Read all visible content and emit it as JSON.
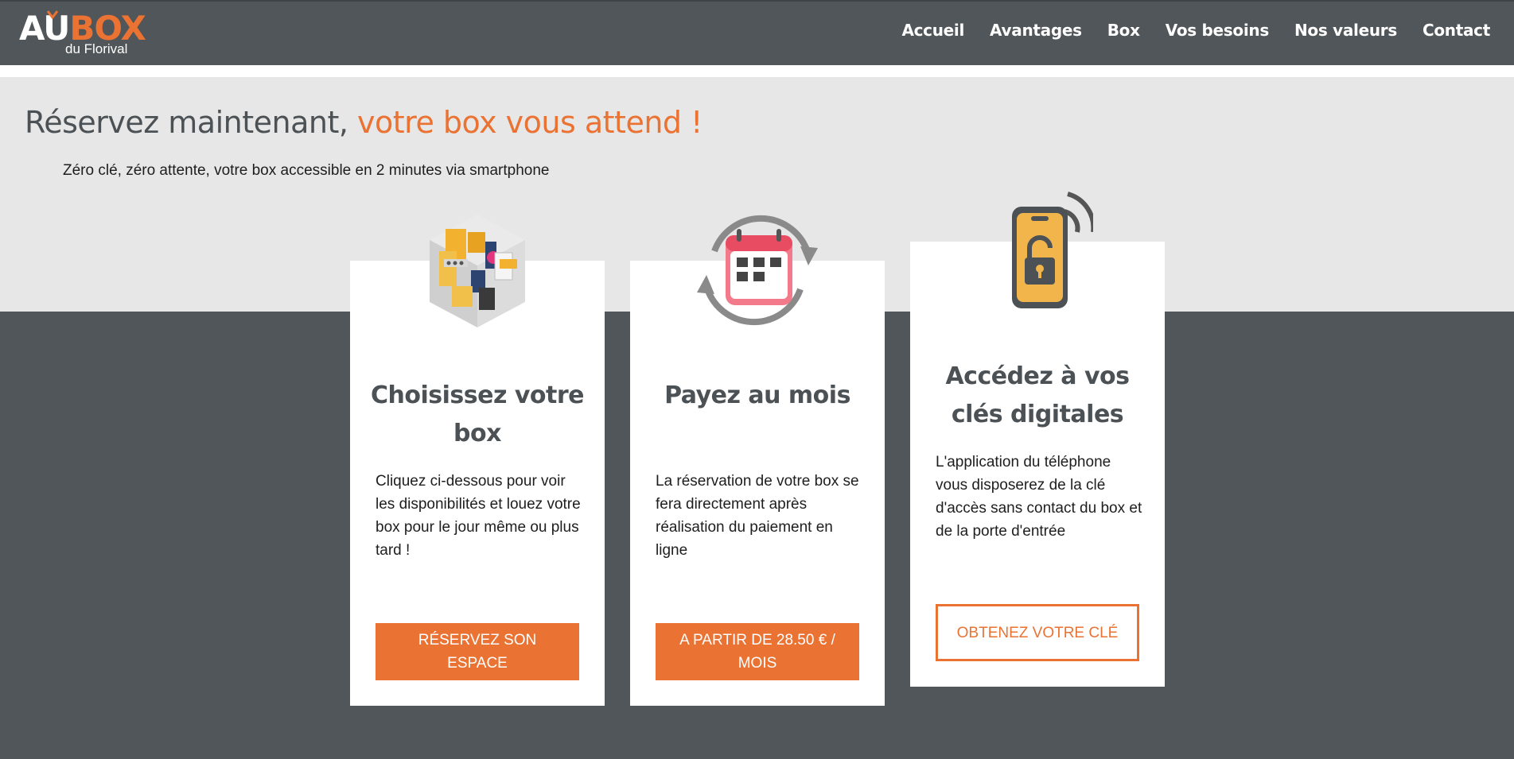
{
  "brand": {
    "logo_au": "AU",
    "logo_box": "BOX",
    "logo_sub": "du Florival",
    "accent_color": "#ea7232",
    "dark_color": "#505659"
  },
  "nav": {
    "items": [
      {
        "label": "Accueil"
      },
      {
        "label": "Avantages"
      },
      {
        "label": "Box"
      },
      {
        "label": "Vos besoins"
      },
      {
        "label": "Nos valeurs"
      },
      {
        "label": "Contact"
      }
    ]
  },
  "hero": {
    "title_main": "Réservez maintenant, ",
    "title_accent": "votre box vous attend !",
    "subtitle": "Zéro clé, zéro attente, votre box accessible en 2 minutes via smartphone"
  },
  "cards": [
    {
      "icon": "storage-box-icon",
      "title": "Choisissez votre box",
      "text": "Cliquez ci-dessous pour voir les disponibilités et louez votre box pour le jour même ou plus tard !",
      "button": "RÉSERVEZ SON ESPACE"
    },
    {
      "icon": "calendar-refresh-icon",
      "title": "Payez au mois",
      "text": "La réservation de votre box se fera directement après réalisation du paiement en ligne",
      "button": "A PARTIR DE 28.50 € / MOIS"
    },
    {
      "icon": "phone-unlock-icon",
      "title": "Accédez à vos clés digitales",
      "text": "L'application du téléphone vous disposerez de la clé d'accès sans contact du box et de la porte d'entrée",
      "button": "OBTENEZ VOTRE CLÉ"
    }
  ]
}
